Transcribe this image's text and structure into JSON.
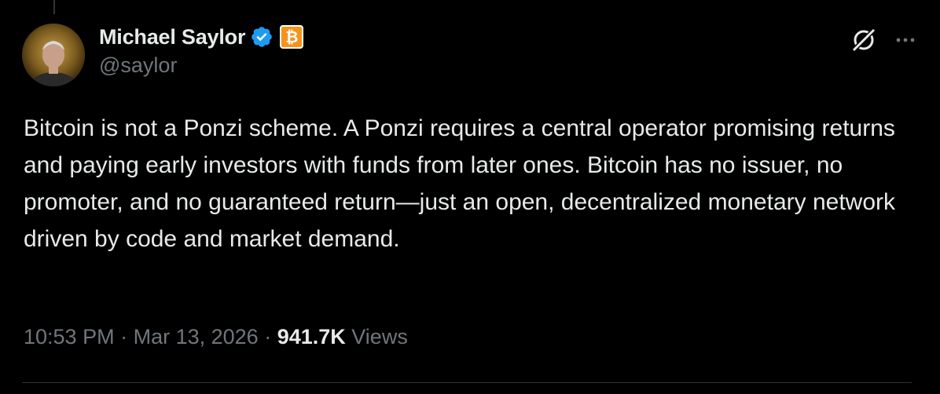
{
  "author": {
    "display_name": "Michael Saylor",
    "handle": "@saylor",
    "verified": true,
    "affiliate_badge_icon": "bitcoin-icon",
    "affiliate_badge_glyph": "₿"
  },
  "tweet": {
    "text": "Bitcoin is not a Ponzi scheme. A Ponzi requires a central operator promising returns and paying early investors with funds from later ones. Bitcoin has no issuer, no promoter, and no guaranteed return—just an open, decentralized monetary network driven by code and market demand.",
    "time": "10:53 PM",
    "separator": " · ",
    "date": "Mar 13, 2026",
    "views_count": "941.7K",
    "views_label": "Views"
  },
  "actions": {
    "grok_icon": "grok-icon",
    "more_icon": "more-icon"
  },
  "colors": {
    "background": "#000000",
    "primary_text": "#e7e9ea",
    "secondary_text": "#71767b",
    "verified_blue": "#1d9bf0",
    "bitcoin_orange": "#f7931a",
    "divider": "#2f3336"
  }
}
